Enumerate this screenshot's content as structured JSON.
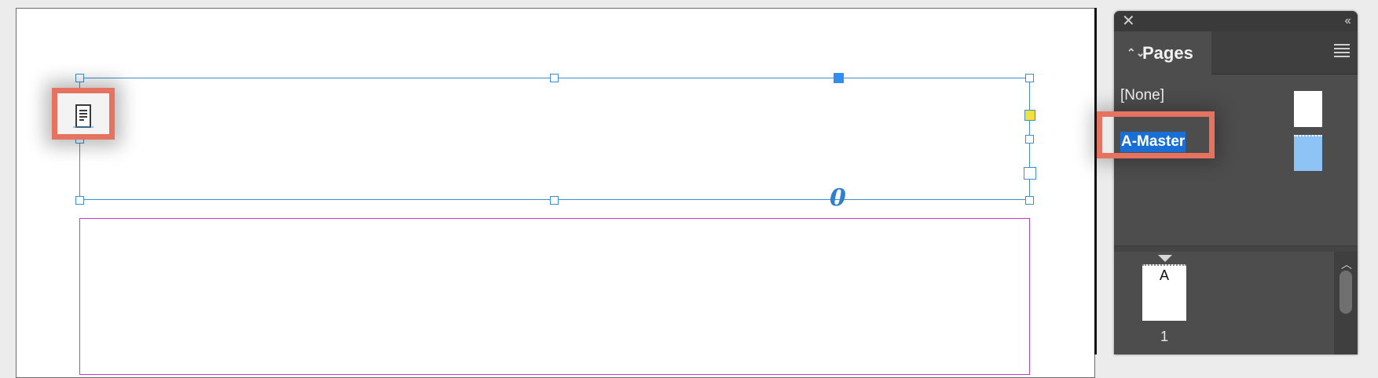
{
  "panel": {
    "close_label": "✕",
    "collapse_label": "‹‹",
    "tab_label": "Pages",
    "tab_arrows": "⌃⌄"
  },
  "masters": {
    "none_label": "[None]",
    "a_master_label": "A-Master"
  },
  "pages": {
    "thumb_master_letter": "A",
    "page_number": "1"
  },
  "canvas": {
    "overset_glyph": "0"
  },
  "colors": {
    "highlight": "#e5735f",
    "selection": "#1a6fd6",
    "frame": "#3f8fd0",
    "margin_guide": "#c23bc2"
  }
}
